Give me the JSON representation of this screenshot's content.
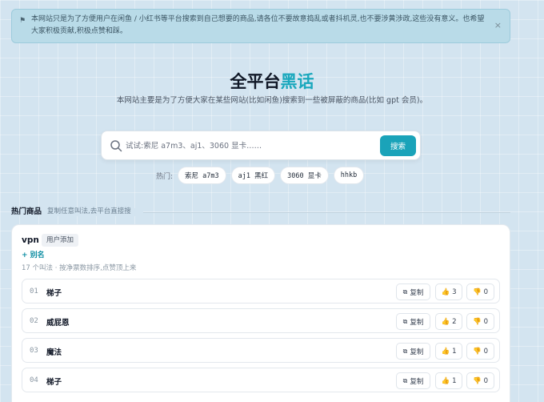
{
  "notice": {
    "icon": "megaphone-icon",
    "text": "本网站只是为了方便用户在闲鱼 / 小红书等平台搜索到自己想要的商品,请各位不要故意捣乱或者抖机灵,也不要涉黄涉政,这些没有意义。也希望大家积极贡献,积极点赞和踩。",
    "close": "×"
  },
  "hero": {
    "title_main": "全平台",
    "title_accent": "黑话",
    "subtitle": "本网站主要是为了方便大家在某些网站(比如闲鱼)搜索到一些被屏蔽的商品(比如 gpt 会员)。"
  },
  "search": {
    "placeholder": "试试:索尼 a7m3、aj1、3060 显卡……",
    "value": "",
    "button": "搜索"
  },
  "hot": {
    "label": "热门:",
    "chips": [
      "索尼 a7m3",
      "aj1 黑红",
      "3060 显卡",
      "hhkb"
    ]
  },
  "section": {
    "title": "热门商品",
    "hint": "复制任意叫法,去平台直接搜"
  },
  "card": {
    "name": "vpn",
    "tag": "用户添加",
    "alias_link": "+ 别名",
    "meta": "17 个叫法 · 按净票数排序,点赞顶上来",
    "copy_label": "复制",
    "rows": [
      {
        "num": "01",
        "word": "梯子",
        "up": "3",
        "down": "0"
      },
      {
        "num": "02",
        "word": "威屁恩",
        "up": "2",
        "down": "0"
      },
      {
        "num": "03",
        "word": "魔法",
        "up": "1",
        "down": "0"
      },
      {
        "num": "04",
        "word": "梯子",
        "up": "1",
        "down": "0"
      }
    ]
  },
  "colors": {
    "accent": "#1aa3b9",
    "background": "#d3e4f0"
  }
}
